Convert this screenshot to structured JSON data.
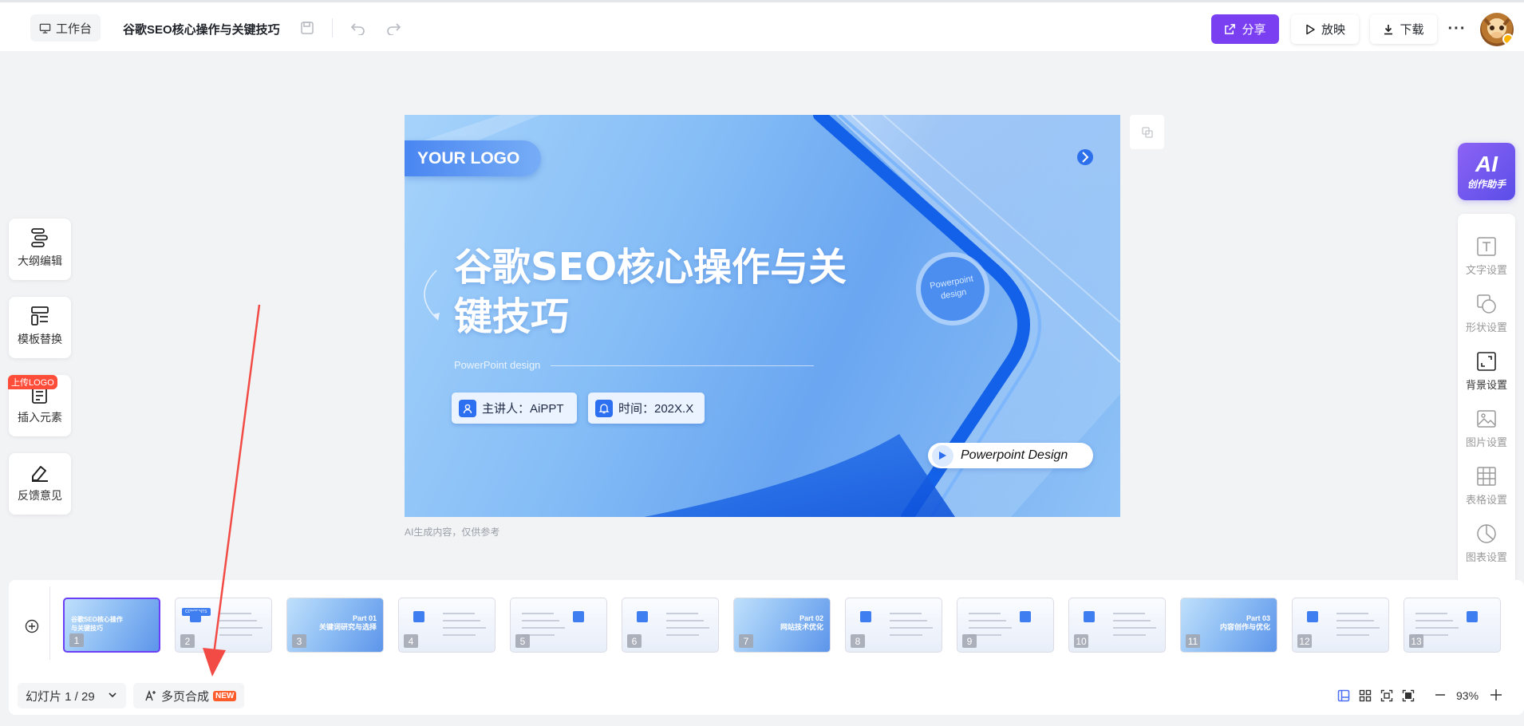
{
  "header": {
    "workspace_label": "工作台",
    "doc_title": "谷歌SEO核心操作与关键技巧",
    "share_label": "分享",
    "play_label": "放映",
    "download_label": "下载",
    "colors": {
      "accent": "#7b3ff2"
    }
  },
  "left_tools": [
    {
      "label": "大纲编辑",
      "icon": "outline-icon"
    },
    {
      "label": "模板替换",
      "icon": "template-icon"
    },
    {
      "label": "插入元素",
      "icon": "insert-icon",
      "badge": "上传LOGO"
    },
    {
      "label": "反馈意见",
      "icon": "feedback-icon"
    }
  ],
  "slide": {
    "logo_text": "YOUR LOGO",
    "title_line1": "谷歌SEO核心操作与关",
    "title_line2": "键技巧",
    "subtitle": "PowerPoint design",
    "presenter": "主讲人：AiPPT",
    "time": "时间：202X.X",
    "circle_text_1": "Powerpoint",
    "circle_text_2": "design",
    "pill_text": "Powerpoint Design",
    "note": "AI生成内容，仅供参考"
  },
  "ai_assistant": {
    "label": "AI",
    "sub": "创作助手"
  },
  "right_panel": [
    {
      "label": "文字设置",
      "icon": "text-settings-icon"
    },
    {
      "label": "形状设置",
      "icon": "shape-settings-icon"
    },
    {
      "label": "背景设置",
      "icon": "background-settings-icon"
    },
    {
      "label": "图片设置",
      "icon": "image-settings-icon"
    },
    {
      "label": "表格设置",
      "icon": "table-settings-icon"
    },
    {
      "label": "图表设置",
      "icon": "chart-settings-icon"
    }
  ],
  "thumbnails": [
    {
      "num": "1",
      "style": "blue",
      "text": "谷歌SEO核心操作与关键技巧"
    },
    {
      "num": "2",
      "style": "white",
      "text": "CONTENTS"
    },
    {
      "num": "3",
      "style": "blue",
      "part": "Part 01",
      "text": "关键词研究与选择"
    },
    {
      "num": "4",
      "style": "white",
      "text": ""
    },
    {
      "num": "5",
      "style": "white",
      "text": ""
    },
    {
      "num": "6",
      "style": "white",
      "text": ""
    },
    {
      "num": "7",
      "style": "blue",
      "part": "Part 02",
      "text": "网站技术优化"
    },
    {
      "num": "8",
      "style": "white",
      "text": ""
    },
    {
      "num": "9",
      "style": "white",
      "text": ""
    },
    {
      "num": "10",
      "style": "white",
      "text": ""
    },
    {
      "num": "11",
      "style": "blue",
      "part": "Part 03",
      "text": "内容创作与优化"
    },
    {
      "num": "12",
      "style": "white",
      "text": ""
    },
    {
      "num": "13",
      "style": "white",
      "text": ""
    }
  ],
  "footer": {
    "slide_counter": "幻灯片 1 / 29",
    "multi_page_label": "多页合成",
    "new_badge": "NEW",
    "zoom": "93%"
  }
}
